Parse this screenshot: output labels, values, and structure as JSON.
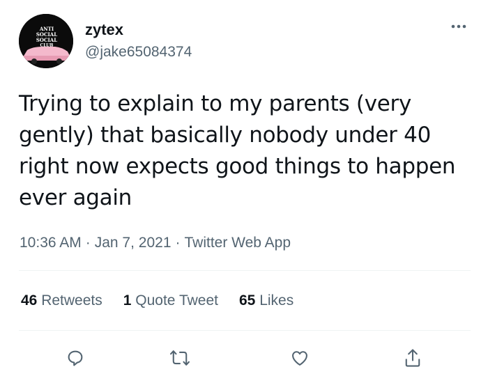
{
  "author": {
    "display_name": "zytex",
    "handle": "@jake65084374",
    "avatar_text": "ANTI SOCIAL SOCIAL CLUB"
  },
  "tweet": {
    "text": "Trying to explain to my parents (very gently) that basically nobody under 40 right now expects good things to happen ever again",
    "time": "10:36 AM",
    "separator": "·",
    "date": "Jan 7, 2021",
    "source": "Twitter Web App"
  },
  "stats": {
    "retweets": {
      "count": "46",
      "label": "Retweets"
    },
    "quotes": {
      "count": "1",
      "label": "Quote Tweet"
    },
    "likes": {
      "count": "65",
      "label": "Likes"
    }
  },
  "actions": [
    "reply-icon",
    "retweet-icon",
    "like-icon",
    "share-icon"
  ],
  "colors": {
    "primary_text": "#0f1419",
    "secondary_text": "#536471",
    "divider": "#eff3f4",
    "background": "#ffffff"
  }
}
